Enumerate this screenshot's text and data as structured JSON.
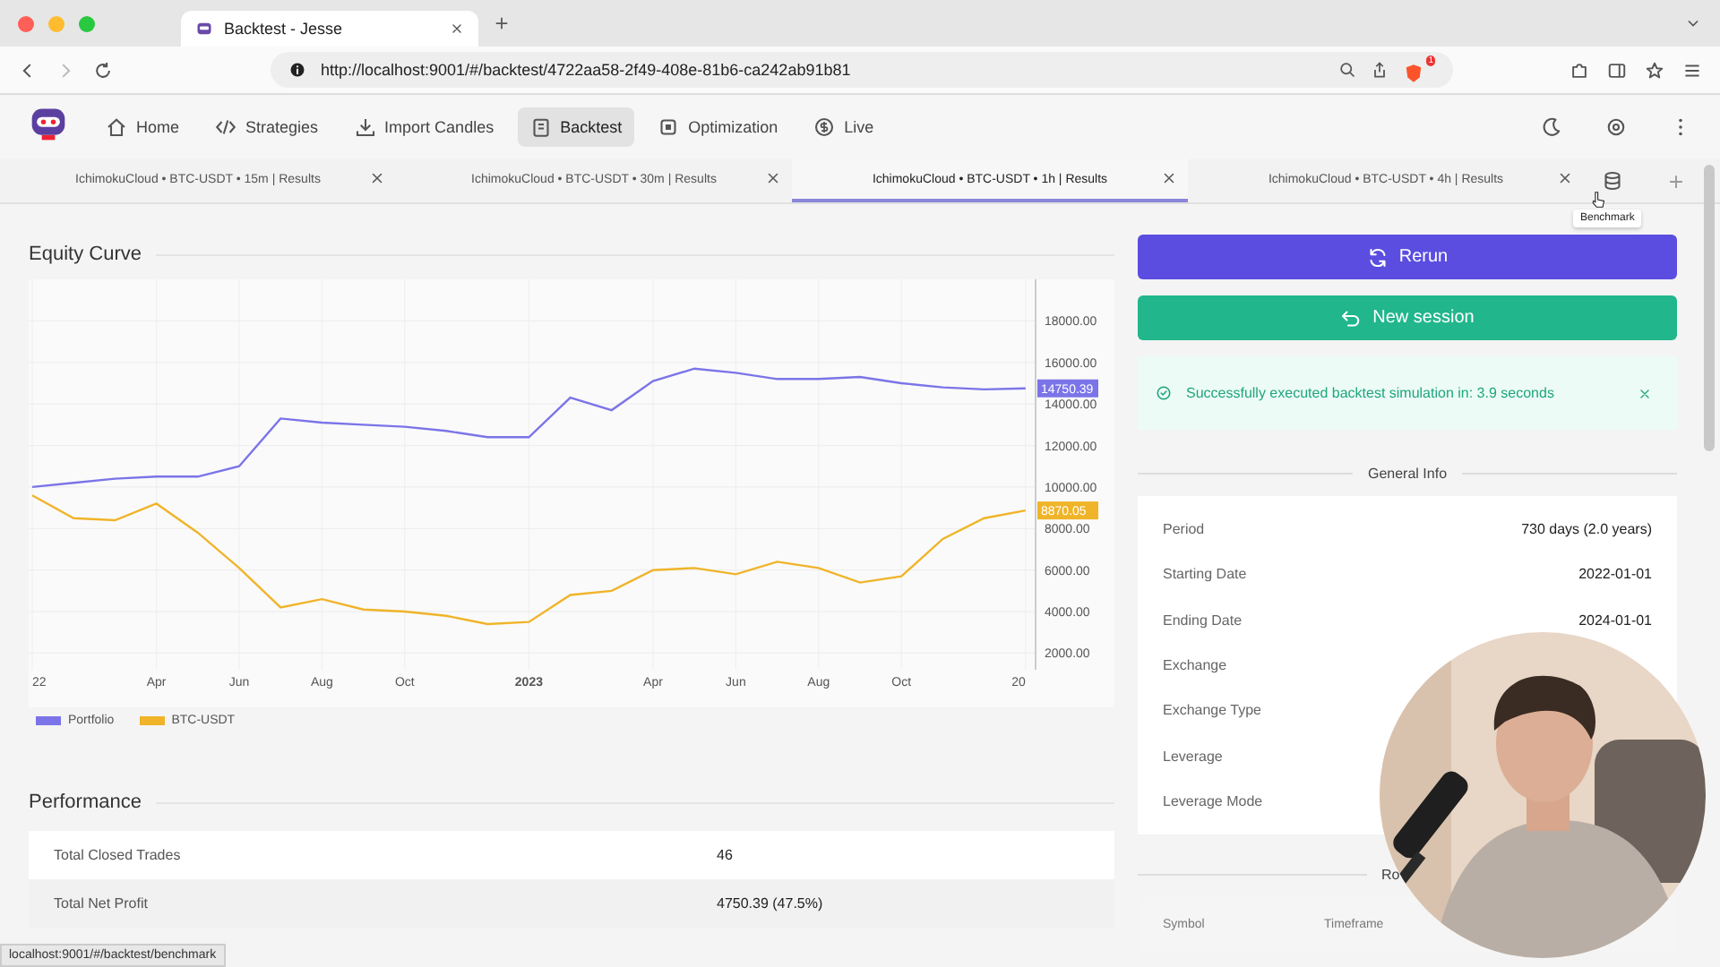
{
  "browser": {
    "tab_title": "Backtest - Jesse",
    "url": "http://localhost:9001/#/backtest/4722aa58-2f49-408e-81b6-ca242ab91b81",
    "shield_badge": "1"
  },
  "nav": {
    "items": [
      {
        "label": "Home",
        "selected": false
      },
      {
        "label": "Strategies",
        "selected": false
      },
      {
        "label": "Import Candles",
        "selected": false
      },
      {
        "label": "Backtest",
        "selected": true
      },
      {
        "label": "Optimization",
        "selected": false
      },
      {
        "label": "Live",
        "selected": false
      }
    ]
  },
  "session_tabs": [
    {
      "label": "IchimokuCloud • BTC-USDT • 15m | Results",
      "selected": false
    },
    {
      "label": "IchimokuCloud • BTC-USDT • 30m | Results",
      "selected": false
    },
    {
      "label": "IchimokuCloud • BTC-USDT • 1h | Results",
      "selected": true
    },
    {
      "label": "IchimokuCloud • BTC-USDT • 4h | Results",
      "selected": false
    }
  ],
  "benchmark_tooltip": "Benchmark",
  "equity_curve": {
    "title": "Equity Curve",
    "end_labels": [
      "14750.39",
      "8870.05"
    ],
    "chart_data": {
      "type": "line",
      "categories": [
        "22",
        null,
        null,
        "Apr",
        null,
        "Jun",
        null,
        "Aug",
        null,
        "Oct",
        null,
        null,
        "2023",
        null,
        null,
        "Apr",
        null,
        "Jun",
        null,
        "Aug",
        null,
        "Oct",
        null,
        null,
        "20"
      ],
      "ylim": [
        1200,
        20000
      ],
      "grid": true,
      "series": [
        {
          "name": "Portfolio",
          "color": "#7b74e8",
          "values": [
            10000,
            10200,
            10400,
            10500,
            10500,
            11000,
            13300,
            13100,
            13000,
            12900,
            12700,
            12400,
            12400,
            14300,
            13700,
            15100,
            15700,
            15500,
            15200,
            15200,
            15300,
            15000,
            14800,
            14700,
            14750
          ]
        },
        {
          "name": "BTC-USDT",
          "color": "#f0b429",
          "values": [
            9600,
            8500,
            8400,
            9200,
            7800,
            6100,
            4200,
            4600,
            4100,
            4000,
            3800,
            3400,
            3500,
            4800,
            5000,
            6000,
            6100,
            5800,
            6400,
            6100,
            5400,
            5700,
            7500,
            8500,
            8870
          ]
        }
      ],
      "yticks": [
        {
          "value": 2000,
          "label": "2000.00"
        },
        {
          "value": 4000,
          "label": "4000.00"
        },
        {
          "value": 6000,
          "label": "6000.00"
        },
        {
          "value": 8000,
          "label": "8000.00"
        },
        {
          "value": 10000,
          "label": "10000.00"
        },
        {
          "value": 12000,
          "label": "12000.00"
        },
        {
          "value": 14000,
          "label": "14000.00"
        },
        {
          "value": 16000,
          "label": "16000.00"
        },
        {
          "value": 18000,
          "label": "18000.00"
        }
      ]
    }
  },
  "performance": {
    "title": "Performance",
    "rows": [
      {
        "label": "Total Closed Trades",
        "value": "46"
      },
      {
        "label": "Total Net Profit",
        "value": "4750.39 (47.5%)"
      }
    ]
  },
  "actions": {
    "rerun": "Rerun",
    "new_session": "New session"
  },
  "alert": {
    "message": "Successfully executed backtest simulation in: 3.9 seconds"
  },
  "general_info": {
    "title": "General Info",
    "rows": [
      {
        "label": "Period",
        "value": "730 days (2.0 years)"
      },
      {
        "label": "Starting Date",
        "value": "2022-01-01"
      },
      {
        "label": "Ending Date",
        "value": "2024-01-01"
      },
      {
        "label": "Exchange"
      },
      {
        "label": "Exchange Type"
      },
      {
        "label": "Leverage"
      },
      {
        "label": "Leverage Mode"
      }
    ]
  },
  "routes": {
    "title": "Ro",
    "columns": [
      "Symbol",
      "Timeframe"
    ]
  },
  "status_link": "localhost:9001/#/backtest/benchmark"
}
